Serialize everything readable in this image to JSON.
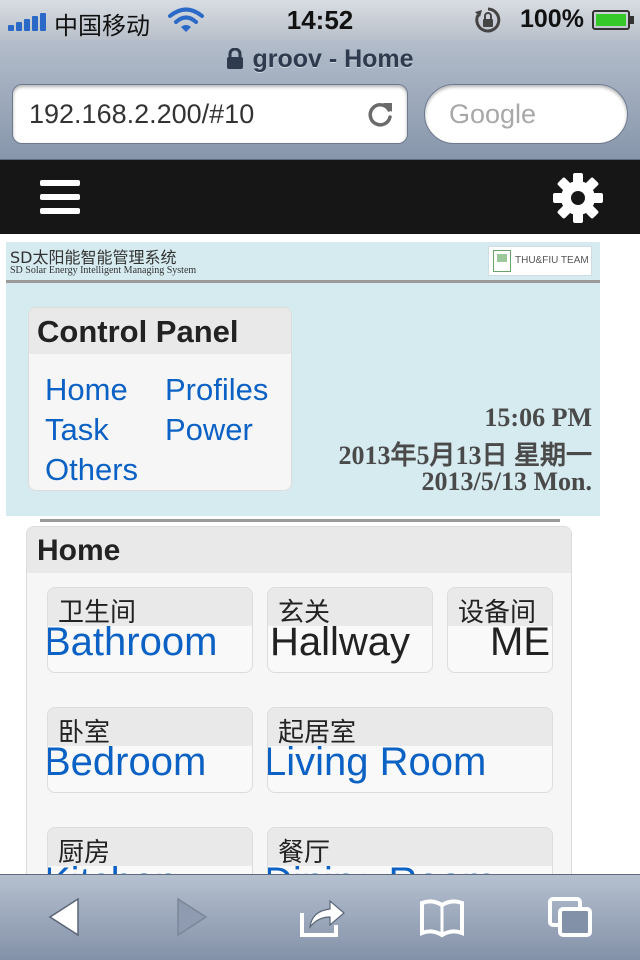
{
  "status_bar": {
    "carrier": "中国移动",
    "time": "14:52",
    "battery_percent": "100%",
    "battery_level": 1.0
  },
  "browser": {
    "page_title": "groov - Home",
    "url": "192.168.2.200/#10",
    "search_placeholder": "Google"
  },
  "banner": {
    "title_cn": "SD太阳能智能管理系统",
    "title_en": "SD Solar Energy Intelligent Managing System",
    "team": "THU&FIU TEAM"
  },
  "control_panel": {
    "title": "Control Panel",
    "links": {
      "home": "Home",
      "profiles": "Profiles",
      "task": "Task",
      "power": "Power",
      "others": "Others"
    }
  },
  "datetime": {
    "time": "15:06 PM",
    "date_cn": "2013年5月13日 星期一",
    "date_en": "2013/5/13 Mon."
  },
  "home": {
    "title": "Home",
    "rooms": [
      {
        "cn": "卫生间",
        "en": "Bathroom",
        "color": "#0b61c4"
      },
      {
        "cn": "玄关",
        "en": "Hallway",
        "color": "#222222"
      },
      {
        "cn": "设备间",
        "en": "ME",
        "color": "#222222"
      },
      {
        "cn": "卧室",
        "en": "Bedroom",
        "color": "#0b61c4"
      },
      {
        "cn": "起居室",
        "en": "Living Room",
        "color": "#0b61c4"
      },
      {
        "cn": "厨房",
        "en": "Kitchen",
        "color": "#0b61c4"
      },
      {
        "cn": "餐厅",
        "en": "Dining Room",
        "color": "#0b61c4"
      }
    ]
  },
  "colors": {
    "link": "#0b61c4",
    "banner_bg": "#d5ebf0",
    "app_header": "#161616"
  }
}
